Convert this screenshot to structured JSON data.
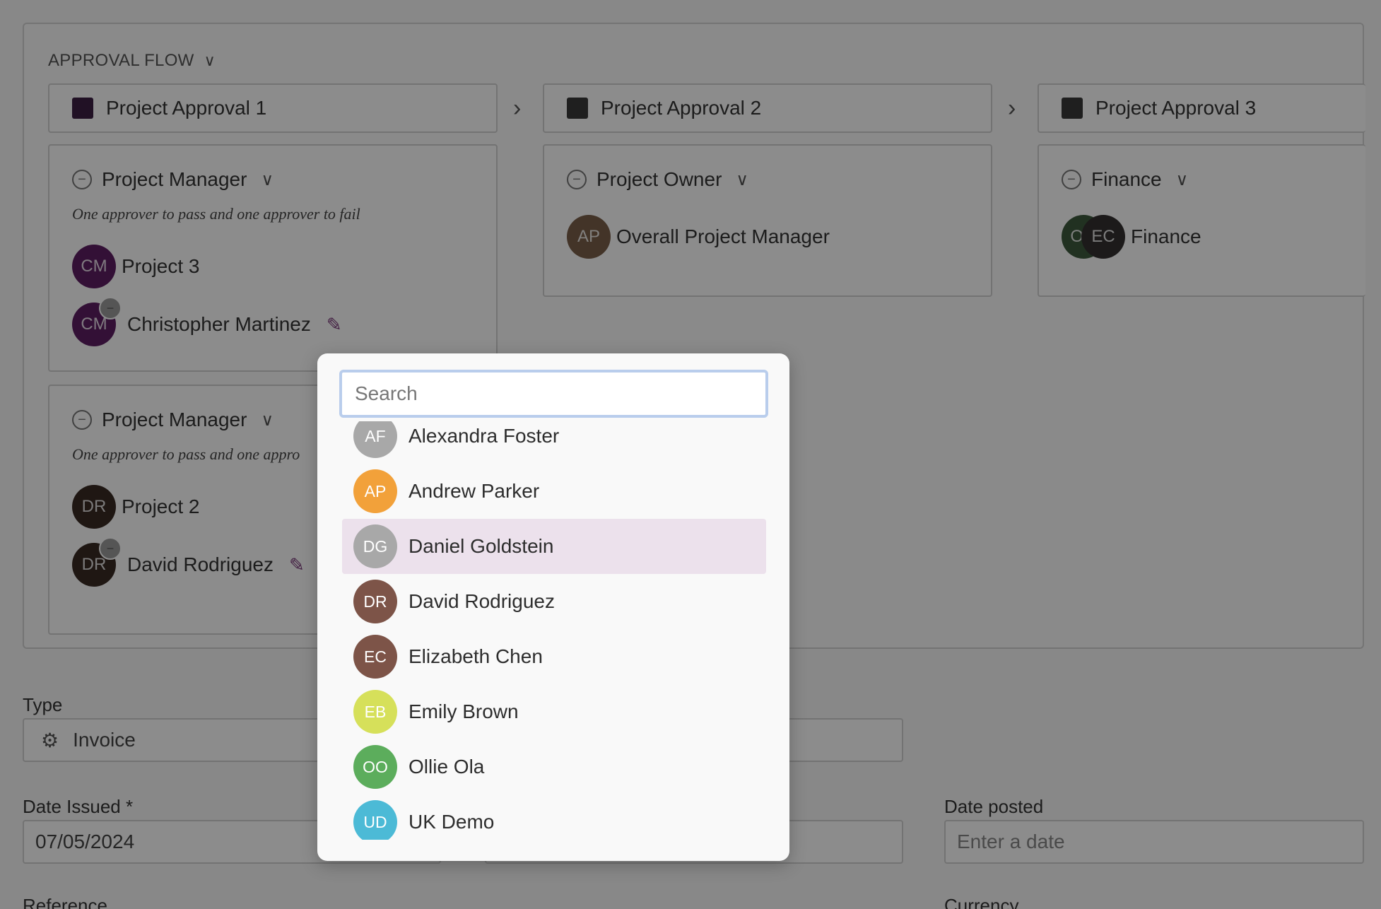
{
  "flow": {
    "title": "APPROVAL FLOW",
    "stages": [
      {
        "label": "Project Approval 1",
        "color": "#3c1f44",
        "roles": [
          {
            "name": "Project Manager",
            "rule": "One approver to pass and one approver to fail",
            "members": [
              {
                "initials": "CM",
                "name": "Project 3",
                "color": "#5e1e63"
              },
              {
                "initials": "CM",
                "name": "Christopher Martinez",
                "color": "#5e1e63"
              }
            ]
          },
          {
            "name": "Project Manager",
            "rule": "One approver to pass and one appro",
            "members": [
              {
                "initials": "DR",
                "name": "Project 2",
                "color": "#3a2a24"
              },
              {
                "initials": "DR",
                "name": "David Rodriguez",
                "color": "#3a2a24"
              }
            ]
          }
        ]
      },
      {
        "label": "Project Approval 2",
        "color": "#3a3a3a",
        "roles": [
          {
            "name": "Project Owner",
            "members": [
              {
                "initials": "AP",
                "name": "Overall Project Manager",
                "color": "#7a5f4a"
              }
            ]
          }
        ]
      },
      {
        "label": "Project Approval 3",
        "color": "#3a3a3a",
        "roles": [
          {
            "name": "Finance",
            "members": [
              {
                "initials": "OO",
                "name": "",
                "color": "#3d5a3d"
              },
              {
                "initials": "EC",
                "name": "Finance",
                "color": "#333030"
              }
            ]
          }
        ]
      }
    ]
  },
  "form": {
    "type_label": "Type",
    "type_value": "Invoice",
    "date_issued_label": "Date Issued *",
    "date_issued_value": "07/05/2024",
    "date_posted_label": "Date posted",
    "date_posted_placeholder": "Enter a date",
    "reference_label": "Reference",
    "currency_label": "Currency"
  },
  "picker": {
    "search_placeholder": "Search",
    "highlighted_index": 2,
    "people": [
      {
        "initials": "AF",
        "name": "Alexandra Foster",
        "color": "#a8a8a8"
      },
      {
        "initials": "AP",
        "name": "Andrew Parker",
        "color": "#f2a13a"
      },
      {
        "initials": "DG",
        "name": "Daniel Goldstein",
        "color": "#a8a8a8"
      },
      {
        "initials": "DR",
        "name": "David Rodriguez",
        "color": "#7d5448"
      },
      {
        "initials": "EC",
        "name": "Elizabeth Chen",
        "color": "#7d5448"
      },
      {
        "initials": "EB",
        "name": "Emily Brown",
        "color": "#d6e05a"
      },
      {
        "initials": "OO",
        "name": "Ollie Ola",
        "color": "#5cad5c"
      },
      {
        "initials": "UD",
        "name": "UK Demo",
        "color": "#4cbad6"
      }
    ]
  }
}
